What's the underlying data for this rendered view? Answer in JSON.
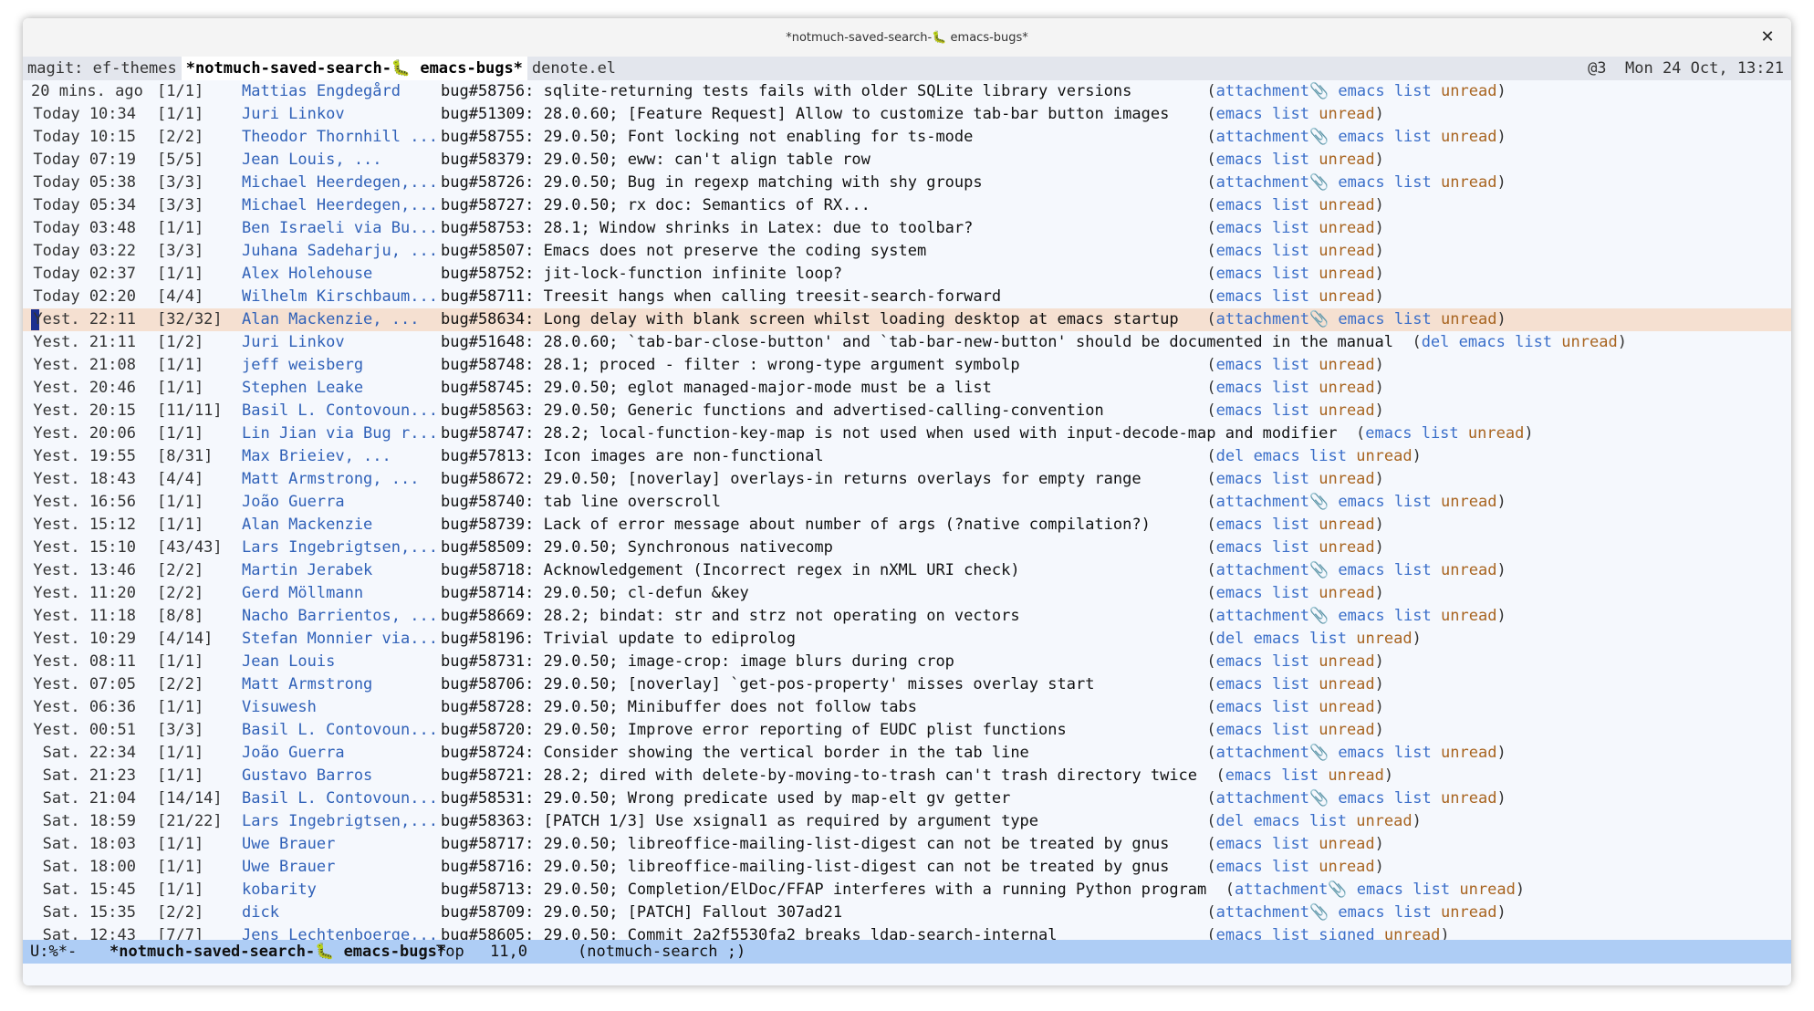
{
  "window": {
    "title": "*notmuch-saved-search-🐛 emacs-bugs*"
  },
  "tabs": [
    {
      "label": "magit: ef-themes",
      "active": false
    },
    {
      "label": "*notmuch-saved-search-🐛 emacs-bugs*",
      "active": true
    },
    {
      "label": "denote.el",
      "active": false
    }
  ],
  "tabbar_right": "@3  Mon 24 Oct, 13:21",
  "colors": {
    "author": "#3061b8",
    "tag_blue": "#3a6ec9",
    "tag_unread": "#a86420",
    "current_line": "#f5e0d1",
    "modeline": "#aecdf5"
  },
  "icons": {
    "attachment": "paperclip-icon",
    "tab_emoji": "bug-icon"
  },
  "threads": [
    {
      "date": "20 mins. ago",
      "count": "[1/1]",
      "authors": "Mattias Engdegård",
      "subject": "bug#58756: sqlite-returning tests fails with older SQLite library versions",
      "tags": [
        "attachment",
        "emacs",
        "list",
        "unread"
      ]
    },
    {
      "date": "Today 10:34",
      "count": "[1/1]",
      "authors": "Juri Linkov",
      "subject": "bug#51309: 28.0.60; [Feature Request] Allow to customize tab-bar button images",
      "tags": [
        "emacs",
        "list",
        "unread"
      ]
    },
    {
      "date": "Today 10:15",
      "count": "[2/2]",
      "authors": "Theodor Thornhill ...",
      "subject": "bug#58755: 29.0.50; Font locking not enabling for ts-mode",
      "tags": [
        "attachment",
        "emacs",
        "list",
        "unread"
      ]
    },
    {
      "date": "Today 07:19",
      "count": "[5/5]",
      "authors": "Jean Louis, ...",
      "subject": "bug#58379: 29.0.50; eww: can't align table row",
      "tags": [
        "emacs",
        "list",
        "unread"
      ]
    },
    {
      "date": "Today 05:38",
      "count": "[3/3]",
      "authors": "Michael Heerdegen,...",
      "subject": "bug#58726: 29.0.50; Bug in regexp matching with shy groups",
      "tags": [
        "attachment",
        "emacs",
        "list",
        "unread"
      ]
    },
    {
      "date": "Today 05:34",
      "count": "[3/3]",
      "authors": "Michael Heerdegen,...",
      "subject": "bug#58727: 29.0.50; rx doc: Semantics of RX...",
      "tags": [
        "emacs",
        "list",
        "unread"
      ]
    },
    {
      "date": "Today 03:48",
      "count": "[1/1]",
      "authors": "Ben Israeli via Bu...",
      "subject": "bug#58753: 28.1; Window shrinks in Latex: due to toolbar?",
      "tags": [
        "emacs",
        "list",
        "unread"
      ]
    },
    {
      "date": "Today 03:22",
      "count": "[3/3]",
      "authors": "Juhana Sadeharju, ...",
      "subject": "bug#58507: Emacs does not preserve the coding system",
      "tags": [
        "emacs",
        "list",
        "unread"
      ]
    },
    {
      "date": "Today 02:37",
      "count": "[1/1]",
      "authors": "Alex Holehouse",
      "subject": "bug#58752: jit-lock-function infinite loop?",
      "tags": [
        "emacs",
        "list",
        "unread"
      ]
    },
    {
      "date": "Today 02:20",
      "count": "[4/4]",
      "authors": "Wilhelm Kirschbaum...",
      "subject": "bug#58711: Treesit hangs when calling treesit-search-forward",
      "tags": [
        "emacs",
        "list",
        "unread"
      ]
    },
    {
      "date": "Yest. 22:11",
      "count": "[32/32]",
      "authors": "Alan Mackenzie, ...",
      "subject": "bug#58634: Long delay with blank screen whilst loading desktop at emacs startup",
      "tags": [
        "attachment",
        "emacs",
        "list",
        "unread"
      ],
      "current": true
    },
    {
      "date": "Yest. 21:11",
      "count": "[1/2]",
      "authors": "Juri Linkov",
      "subject": "bug#51648: 28.0.60; `tab-bar-close-button' and `tab-bar-new-button' should be documented in the manual",
      "tags": [
        "del",
        "emacs",
        "list",
        "unread"
      ]
    },
    {
      "date": "Yest. 21:08",
      "count": "[1/1]",
      "authors": "jeff weisberg",
      "subject": "bug#58748: 28.1; proced - filter : wrong-type argument symbolp",
      "tags": [
        "emacs",
        "list",
        "unread"
      ]
    },
    {
      "date": "Yest. 20:46",
      "count": "[1/1]",
      "authors": "Stephen Leake",
      "subject": "bug#58745: 29.0.50; eglot managed-major-mode must be a list",
      "tags": [
        "emacs",
        "list",
        "unread"
      ]
    },
    {
      "date": "Yest. 20:15",
      "count": "[11/11]",
      "authors": "Basil L. Contovoun...",
      "subject": "bug#58563: 29.0.50; Generic functions and advertised-calling-convention",
      "tags": [
        "emacs",
        "list",
        "unread"
      ]
    },
    {
      "date": "Yest. 20:06",
      "count": "[1/1]",
      "authors": "Lin Jian via Bug r...",
      "subject": "bug#58747: 28.2; local-function-key-map is not used when used with input-decode-map and modifier",
      "tags": [
        "emacs",
        "list",
        "unread"
      ]
    },
    {
      "date": "Yest. 19:55",
      "count": "[8/31]",
      "authors": "Max Brieiev, ...",
      "subject": "bug#57813: Icon images are non-functional",
      "tags": [
        "del",
        "emacs",
        "list",
        "unread"
      ]
    },
    {
      "date": "Yest. 18:43",
      "count": "[4/4]",
      "authors": "Matt Armstrong, ...",
      "subject": "bug#58672: 29.0.50; [noverlay] overlays-in returns overlays for empty range",
      "tags": [
        "emacs",
        "list",
        "unread"
      ]
    },
    {
      "date": "Yest. 16:56",
      "count": "[1/1]",
      "authors": "João Guerra",
      "subject": "bug#58740: tab line overscroll",
      "tags": [
        "attachment",
        "emacs",
        "list",
        "unread"
      ]
    },
    {
      "date": "Yest. 15:12",
      "count": "[1/1]",
      "authors": "Alan Mackenzie",
      "subject": "bug#58739: Lack of error message about number of args (?native compilation?)",
      "tags": [
        "emacs",
        "list",
        "unread"
      ]
    },
    {
      "date": "Yest. 15:10",
      "count": "[43/43]",
      "authors": "Lars Ingebrigtsen,...",
      "subject": "bug#58509: 29.0.50; Synchronous nativecomp",
      "tags": [
        "emacs",
        "list",
        "unread"
      ]
    },
    {
      "date": "Yest. 13:46",
      "count": "[2/2]",
      "authors": "Martin Jerabek",
      "subject": "bug#58718: Acknowledgement (Incorrect regex in nXML URI check)",
      "tags": [
        "attachment",
        "emacs",
        "list",
        "unread"
      ]
    },
    {
      "date": "Yest. 11:20",
      "count": "[2/2]",
      "authors": "Gerd Möllmann",
      "subject": "bug#58714: 29.0.50; cl-defun &key",
      "tags": [
        "emacs",
        "list",
        "unread"
      ]
    },
    {
      "date": "Yest. 11:18",
      "count": "[8/8]",
      "authors": "Nacho Barrientos, ...",
      "subject": "bug#58669: 28.2; bindat: str and strz not operating on vectors",
      "tags": [
        "attachment",
        "emacs",
        "list",
        "unread"
      ]
    },
    {
      "date": "Yest. 10:29",
      "count": "[4/14]",
      "authors": "Stefan Monnier via...",
      "subject": "bug#58196: Trivial update to ediprolog",
      "tags": [
        "del",
        "emacs",
        "list",
        "unread"
      ]
    },
    {
      "date": "Yest. 08:11",
      "count": "[1/1]",
      "authors": "Jean Louis",
      "subject": "bug#58731: 29.0.50; image-crop: image blurs during crop",
      "tags": [
        "emacs",
        "list",
        "unread"
      ]
    },
    {
      "date": "Yest. 07:05",
      "count": "[2/2]",
      "authors": "Matt Armstrong",
      "subject": "bug#58706: 29.0.50; [noverlay] `get-pos-property' misses overlay start",
      "tags": [
        "emacs",
        "list",
        "unread"
      ]
    },
    {
      "date": "Yest. 06:36",
      "count": "[1/1]",
      "authors": "Visuwesh",
      "subject": "bug#58728: 29.0.50; Minibuffer does not follow tabs",
      "tags": [
        "emacs",
        "list",
        "unread"
      ]
    },
    {
      "date": "Yest. 00:51",
      "count": "[3/3]",
      "authors": "Basil L. Contovoun...",
      "subject": "bug#58720: 29.0.50; Improve error reporting of EUDC plist functions",
      "tags": [
        "emacs",
        "list",
        "unread"
      ]
    },
    {
      "date": "Sat. 22:34",
      "count": "[1/1]",
      "authors": "João Guerra",
      "subject": "bug#58724: Consider showing the vertical border in the tab line",
      "tags": [
        "attachment",
        "emacs",
        "list",
        "unread"
      ]
    },
    {
      "date": "Sat. 21:23",
      "count": "[1/1]",
      "authors": "Gustavo Barros",
      "subject": "bug#58721: 28.2; dired with delete-by-moving-to-trash can't trash directory twice",
      "tags": [
        "emacs",
        "list",
        "unread"
      ]
    },
    {
      "date": "Sat. 21:04",
      "count": "[14/14]",
      "authors": "Basil L. Contovoun...",
      "subject": "bug#58531: 29.0.50; Wrong predicate used by map-elt gv getter",
      "tags": [
        "attachment",
        "emacs",
        "list",
        "unread"
      ]
    },
    {
      "date": "Sat. 18:59",
      "count": "[21/22]",
      "authors": "Lars Ingebrigtsen,...",
      "subject": "bug#58363: [PATCH 1/3] Use xsignal1 as required by argument type",
      "tags": [
        "del",
        "emacs",
        "list",
        "unread"
      ]
    },
    {
      "date": "Sat. 18:03",
      "count": "[1/1]",
      "authors": "Uwe Brauer",
      "subject": "bug#58717: 29.0.50; libreoffice-mailing-list-digest can not be treated by gnus",
      "tags": [
        "emacs",
        "list",
        "unread"
      ]
    },
    {
      "date": "Sat. 18:00",
      "count": "[1/1]",
      "authors": "Uwe Brauer",
      "subject": "bug#58716: 29.0.50; libreoffice-mailing-list-digest can not be treated by gnus",
      "tags": [
        "emacs",
        "list",
        "unread"
      ]
    },
    {
      "date": "Sat. 15:45",
      "count": "[1/1]",
      "authors": "kobarity",
      "subject": "bug#58713: 29.0.50; Completion/ElDoc/FFAP interferes with a running Python program",
      "tags": [
        "attachment",
        "emacs",
        "list",
        "unread"
      ]
    },
    {
      "date": "Sat. 15:35",
      "count": "[2/2]",
      "authors": "dick",
      "subject": "bug#58709: 29.0.50; [PATCH] Fallout 307ad21",
      "tags": [
        "attachment",
        "emacs",
        "list",
        "unread"
      ]
    },
    {
      "date": "Sat. 12:43",
      "count": "[7/7]",
      "authors": "Jens Lechtenboerge...",
      "subject": "bug#58605: 29.0.50; Commit 2a2f5530fa2 breaks ldap-search-internal",
      "tags": [
        "emacs",
        "list",
        "signed",
        "unread"
      ]
    }
  ],
  "modeline": {
    "status": "U:%*-",
    "buffer": "*notmuch-saved-search-🐛 emacs-bugs*",
    "position": "Top",
    "linecol": "11,0",
    "mode": "(notmuch-search ;)"
  }
}
